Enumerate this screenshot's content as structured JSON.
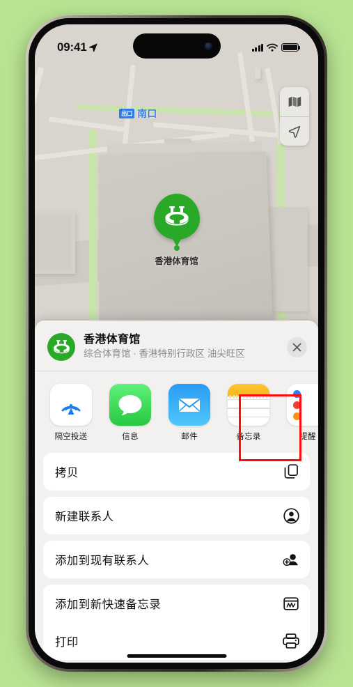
{
  "status_bar": {
    "time": "09:41",
    "location_arrow_icon": "location-arrow-icon",
    "cellular_icon": "cellular-bars-icon",
    "wifi_icon": "wifi-icon",
    "battery_icon": "battery-full-icon"
  },
  "map": {
    "exit_badge": "出口",
    "exit_label": "南口",
    "pin_label": "香港体育馆",
    "pin_icon": "stadium-icon",
    "controls": [
      {
        "name": "map-layers-button",
        "icon": "map-icon"
      },
      {
        "name": "user-location-button",
        "icon": "navigation-arrow-icon"
      }
    ]
  },
  "share_sheet": {
    "place_icon": "stadium-icon",
    "title": "香港体育馆",
    "subtitle": "综合体育馆 · 香港特别行政区 油尖旺区",
    "close_icon": "close-icon",
    "apps": [
      {
        "label": "隔空投送",
        "icon": "airdrop-icon",
        "highlighted": false
      },
      {
        "label": "信息",
        "icon": "messages-icon",
        "highlighted": false
      },
      {
        "label": "邮件",
        "icon": "mail-icon",
        "highlighted": false
      },
      {
        "label": "备忘录",
        "icon": "notes-icon",
        "highlighted": true
      },
      {
        "label": "提醒",
        "icon": "reminders-icon",
        "highlighted": false
      }
    ],
    "actions": [
      {
        "label": "拷贝",
        "icon": "copy-icon"
      },
      {
        "label": "新建联系人",
        "icon": "person-circle-icon"
      },
      {
        "label": "添加到现有联系人",
        "icon": "person-add-icon"
      },
      {
        "label": "添加到新快速备忘录",
        "icon": "quick-note-icon"
      },
      {
        "label": "打印",
        "icon": "printer-icon"
      }
    ]
  },
  "annotation": {
    "color": "#fb0d0d",
    "target": "备忘录"
  },
  "theme": {
    "background": "#b9e392",
    "sheet_bg": "#f2f1ef",
    "accent_green": "#2aa828",
    "link_blue": "#3a7fe0"
  }
}
